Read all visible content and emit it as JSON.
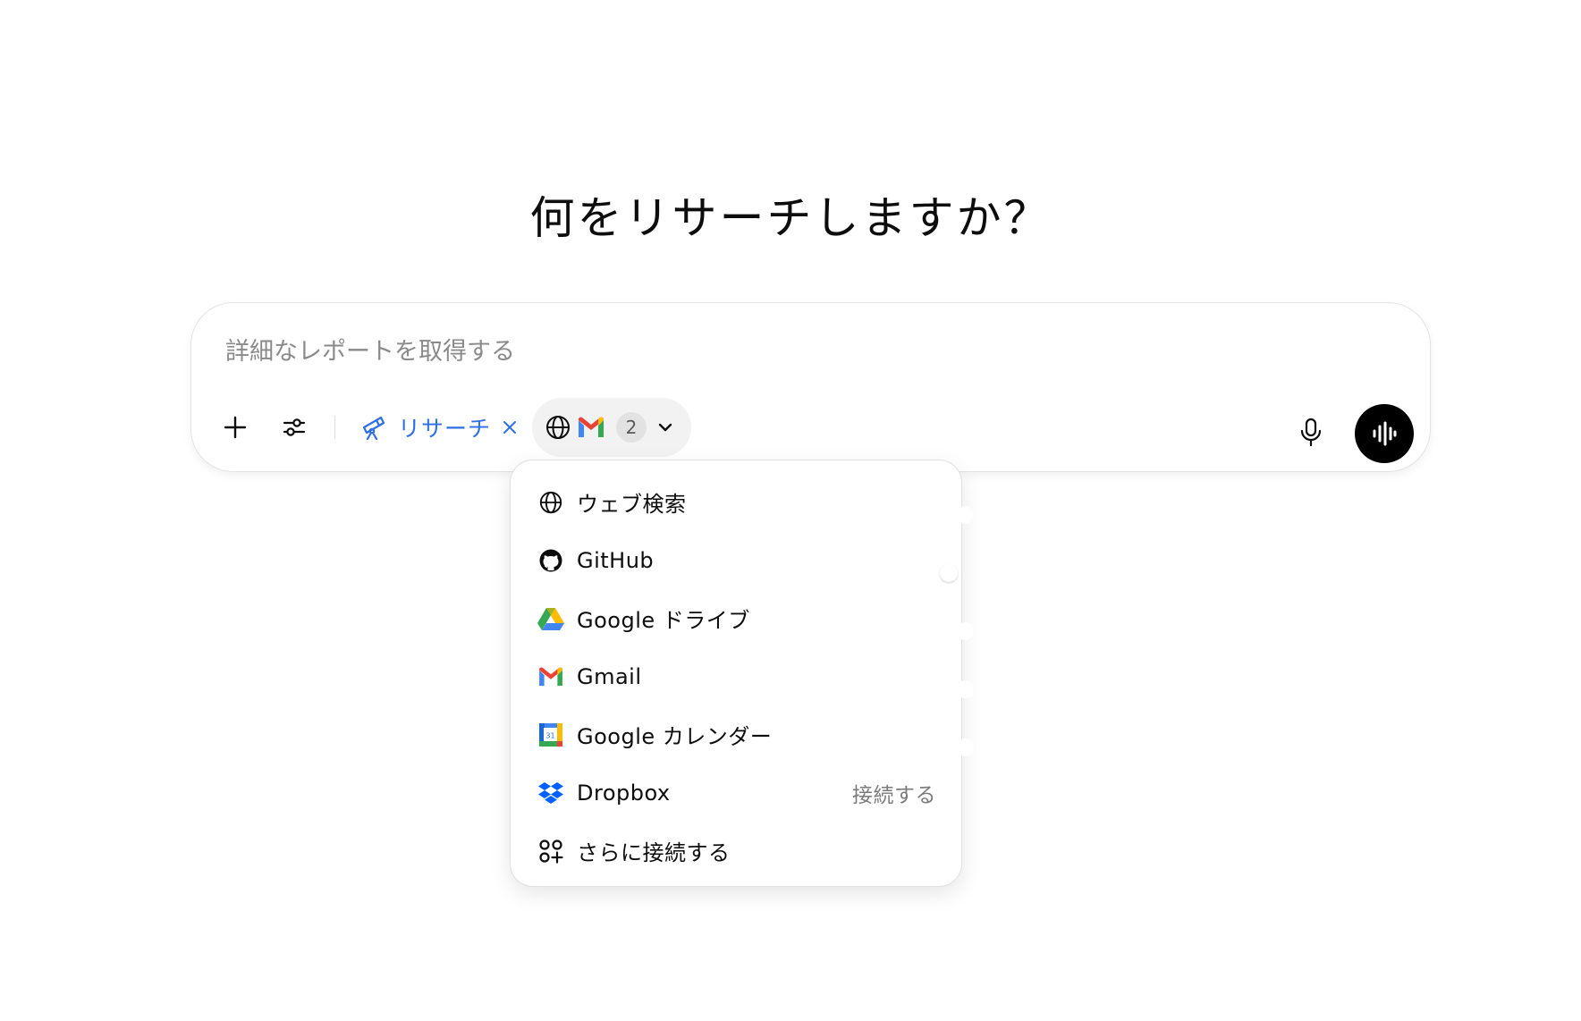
{
  "heading": "何をリサーチしますか？",
  "composer": {
    "placeholder": "詳細なレポートを取得する",
    "value": "",
    "research_chip": {
      "label": "リサーチ"
    },
    "sources_pill": {
      "count": "2"
    }
  },
  "sources_menu": {
    "items": [
      {
        "label": "ウェブ検索",
        "icon": "globe-icon",
        "enabled": true
      },
      {
        "label": "GitHub",
        "icon": "github-icon",
        "enabled": false
      },
      {
        "label": "Google ドライブ",
        "icon": "google-drive-icon",
        "enabled": true
      },
      {
        "label": "Gmail",
        "icon": "gmail-icon",
        "enabled": true
      },
      {
        "label": "Google カレンダー",
        "icon": "google-calendar-icon",
        "enabled": true,
        "calendar_day": "31"
      },
      {
        "label": "Dropbox",
        "icon": "dropbox-icon",
        "action": "接続する"
      },
      {
        "label": "さらに接続する",
        "icon": "apps-add-icon"
      }
    ]
  },
  "colors": {
    "accent": "#2f6fe4",
    "toggle_off": "#e6e6e6",
    "voice_button": "#000000"
  }
}
